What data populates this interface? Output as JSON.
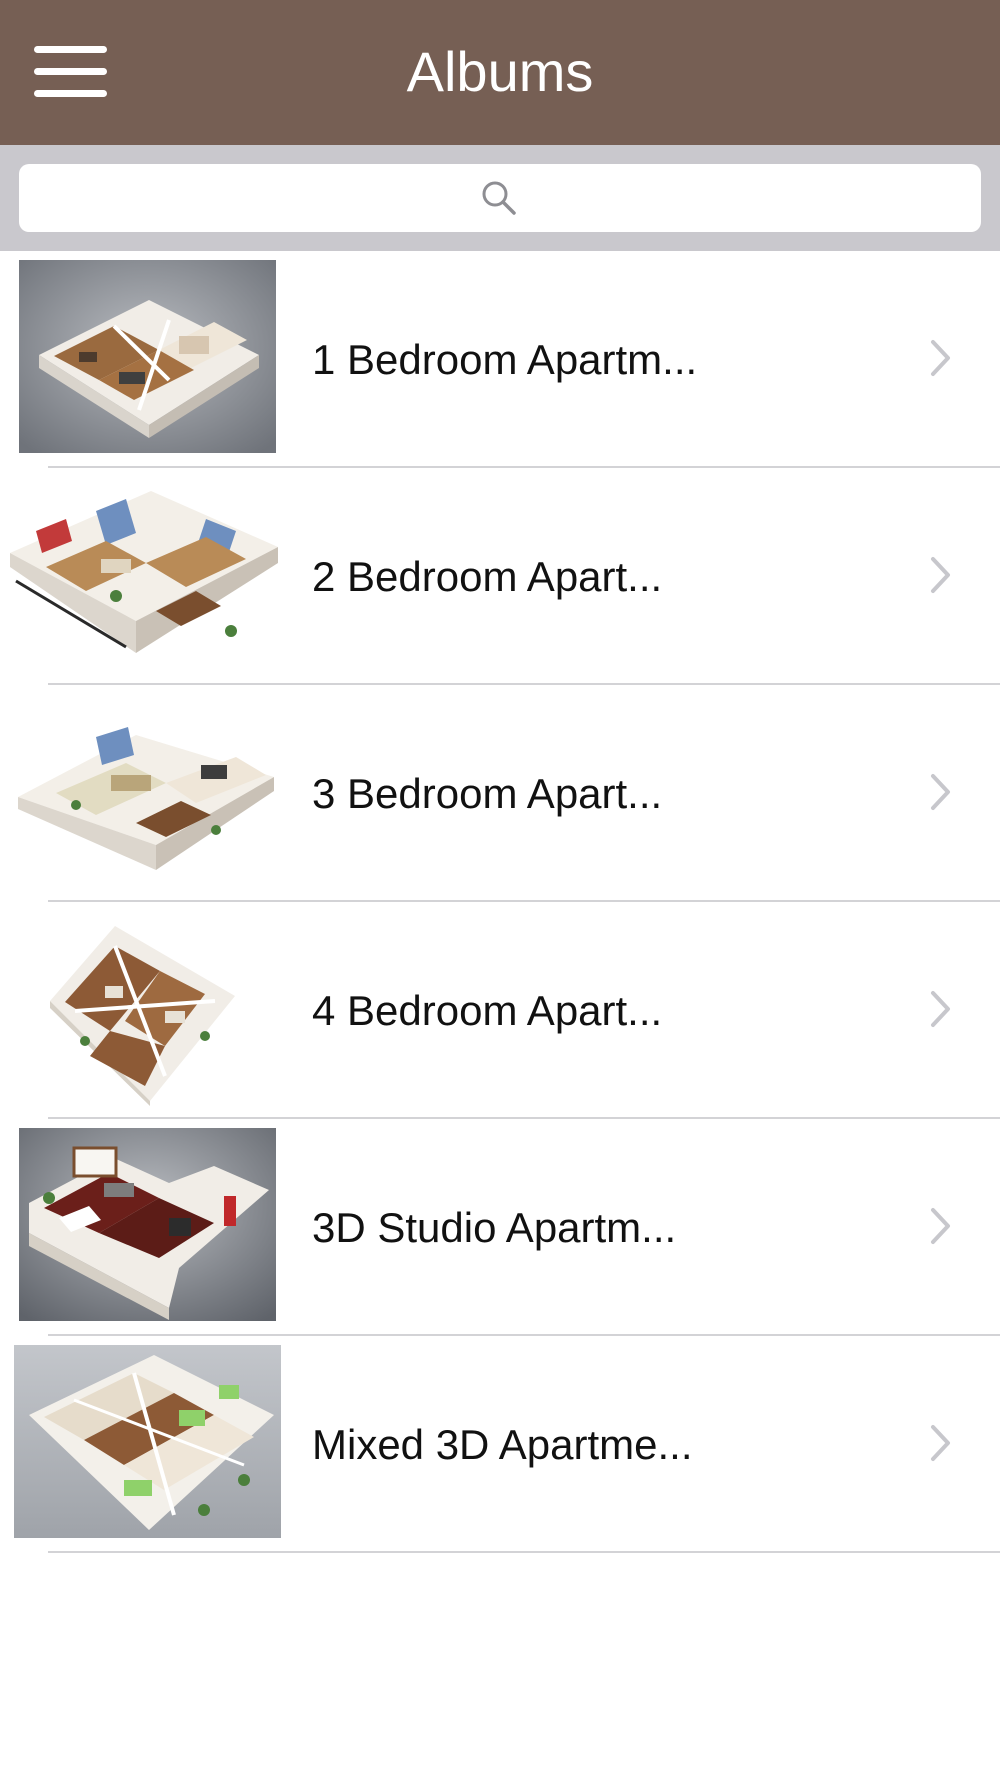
{
  "navbar": {
    "title": "Albums",
    "background_color": "#765f54",
    "menu_icon": "hamburger-menu-icon"
  },
  "search": {
    "placeholder": "",
    "icon": "search-icon"
  },
  "albums": [
    {
      "label": "1 Bedroom Apartm...",
      "thumbnail": "3d-floorplan-1-bedroom"
    },
    {
      "label": "2 Bedroom Apart...",
      "thumbnail": "3d-floorplan-2-bedroom"
    },
    {
      "label": "3 Bedroom Apart...",
      "thumbnail": "3d-floorplan-3-bedroom"
    },
    {
      "label": "4 Bedroom Apart...",
      "thumbnail": "3d-floorplan-4-bedroom"
    },
    {
      "label": "3D Studio Apartm...",
      "thumbnail": "3d-floorplan-studio"
    },
    {
      "label": "Mixed 3D Apartme...",
      "thumbnail": "3d-floorplan-mixed"
    }
  ],
  "row_accessory_icon": "chevron-right-icon"
}
